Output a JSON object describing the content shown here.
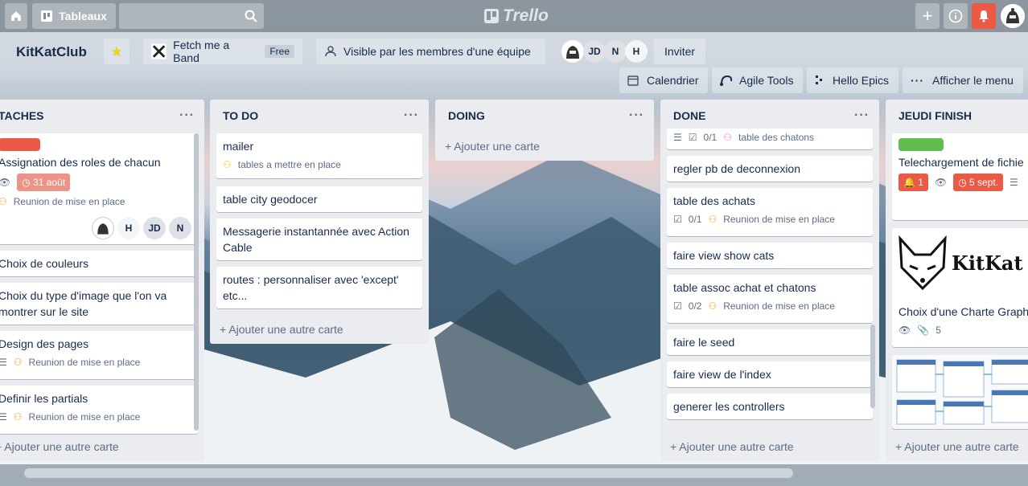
{
  "topbar": {
    "boards_label": "Tableaux",
    "logo": "Trello",
    "icons": [
      "home-icon",
      "board-icon",
      "search-icon",
      "plus-icon",
      "info-icon",
      "bell-icon"
    ]
  },
  "board": {
    "title": "KitKatClub",
    "team_name": "Fetch me a Band",
    "team_plan": "Free",
    "visibility": "Visible par les membres d'une équipe",
    "members": [
      "JD",
      "N",
      "H"
    ],
    "invite": "Inviter",
    "powerups": [
      "Calendrier",
      "Agile Tools",
      "Hello Epics",
      "Afficher le menu"
    ]
  },
  "lists": [
    {
      "title": "TACHES",
      "cards": [
        {
          "title": "Assignation des roles de chacun",
          "label": "#eb5a46",
          "due": "31 août",
          "checklist_name": "Reunion de mise en place",
          "members": [
            "H",
            "JD",
            "N"
          ]
        },
        {
          "title": "Choix de couleurs"
        },
        {
          "title": "Choix du type d'image que l'on va montrer sur le site"
        },
        {
          "title": "Design des pages",
          "checklist_name": "Reunion de mise en place"
        },
        {
          "title": "Definir les partials",
          "checklist_name": "Reunion de mise en place"
        }
      ],
      "add": "Ajouter une autre carte"
    },
    {
      "title": "TO DO",
      "cards": [
        {
          "title": "mailer",
          "checklist_name": "tables a mettre en place"
        },
        {
          "title": "table city geodocer"
        },
        {
          "title": "Messagerie instantannée avec Action Cable"
        },
        {
          "title": "routes : personnaliser avec 'except' etc..."
        }
      ],
      "add": "Ajouter une autre carte"
    },
    {
      "title": "DOING",
      "cards": [],
      "add": "Ajouter une carte"
    },
    {
      "title": "DONE",
      "cards": [
        {
          "checklist": "0/1",
          "checklist_name": "table des chatons"
        },
        {
          "title": "regler pb de deconnexion"
        },
        {
          "title": "table des achats",
          "checklist": "0/1",
          "checklist_name": "Reunion de mise en place"
        },
        {
          "title": "faire view show cats"
        },
        {
          "title": "table assoc achat et chatons",
          "checklist": "0/2",
          "checklist_name": "Reunion de mise en place"
        },
        {
          "title": "faire le seed"
        },
        {
          "title": "faire view de l'index"
        },
        {
          "title": "generer les controllers"
        }
      ],
      "add": "Ajouter une autre carte"
    },
    {
      "title": "JEUDI FINISH",
      "cards": [
        {
          "title": "Telechargement de fichie",
          "label": "#61bd4f",
          "notif": "1",
          "due": "5 sept."
        },
        {
          "title": "Choix d'une Charte Graph",
          "cover_text": "KitKat",
          "attachments": "5"
        },
        {
          "cover": "database-diagram"
        }
      ],
      "add": "Ajouter une autre carte"
    }
  ]
}
